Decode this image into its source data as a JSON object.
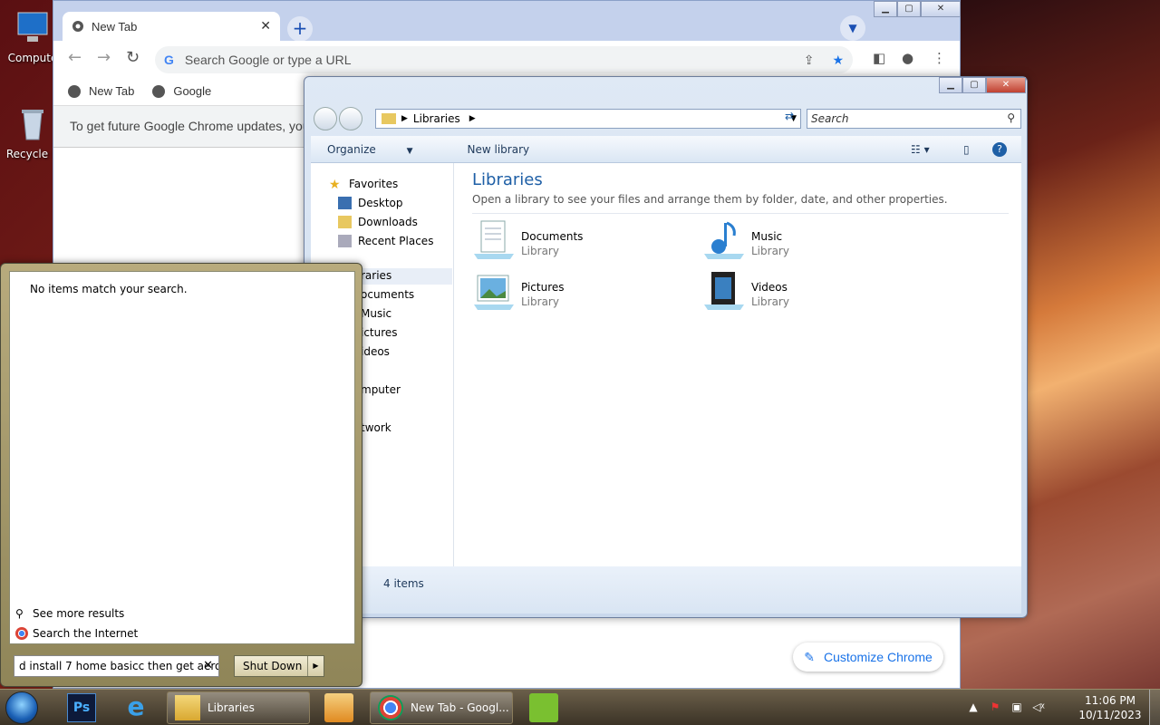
{
  "desktop": {
    "icons": [
      {
        "label": "Compute"
      },
      {
        "label": "Recycle B"
      }
    ]
  },
  "chrome": {
    "tab_title": "New Tab",
    "omnibox_placeholder": "Search Google or type a URL",
    "bookmarks": [
      "New Tab",
      "Google"
    ],
    "infobar_text": "To get future Google Chrome updates, you'll",
    "customize_label": "Customize Chrome"
  },
  "explorer": {
    "address": "Libraries",
    "search_placeholder": "Search",
    "commands": {
      "organize": "Organize",
      "new_library": "New library"
    },
    "nav": {
      "favorites": "Favorites",
      "favorites_items": [
        "Desktop",
        "Downloads",
        "Recent Places"
      ],
      "libraries": "raries",
      "library_items": [
        "ocuments",
        "Music",
        "ictures",
        "ideos"
      ],
      "computer": "mputer",
      "network": "twork"
    },
    "heading": "Libraries",
    "subheading": "Open a library to see your files and arrange them by folder, date, and other properties.",
    "libraries": [
      {
        "name": "Documents",
        "type": "Library"
      },
      {
        "name": "Music",
        "type": "Library"
      },
      {
        "name": "Pictures",
        "type": "Library"
      },
      {
        "name": "Videos",
        "type": "Library"
      }
    ],
    "status": "4 items"
  },
  "start_menu": {
    "no_items": "No items match your search.",
    "see_more": "See more results",
    "search_internet": "Search the Internet",
    "search_value": "d install 7 home basicc then get aero",
    "shutdown_label": "Shut Down"
  },
  "taskbar": {
    "buttons": [
      {
        "label": "Libraries"
      },
      {
        "label": "New Tab - Googl..."
      }
    ],
    "time": "11:06 PM",
    "date": "10/11/2023"
  },
  "colors": {
    "accent": "#1e5fa6",
    "chrome_blue": "#1a73e8"
  }
}
